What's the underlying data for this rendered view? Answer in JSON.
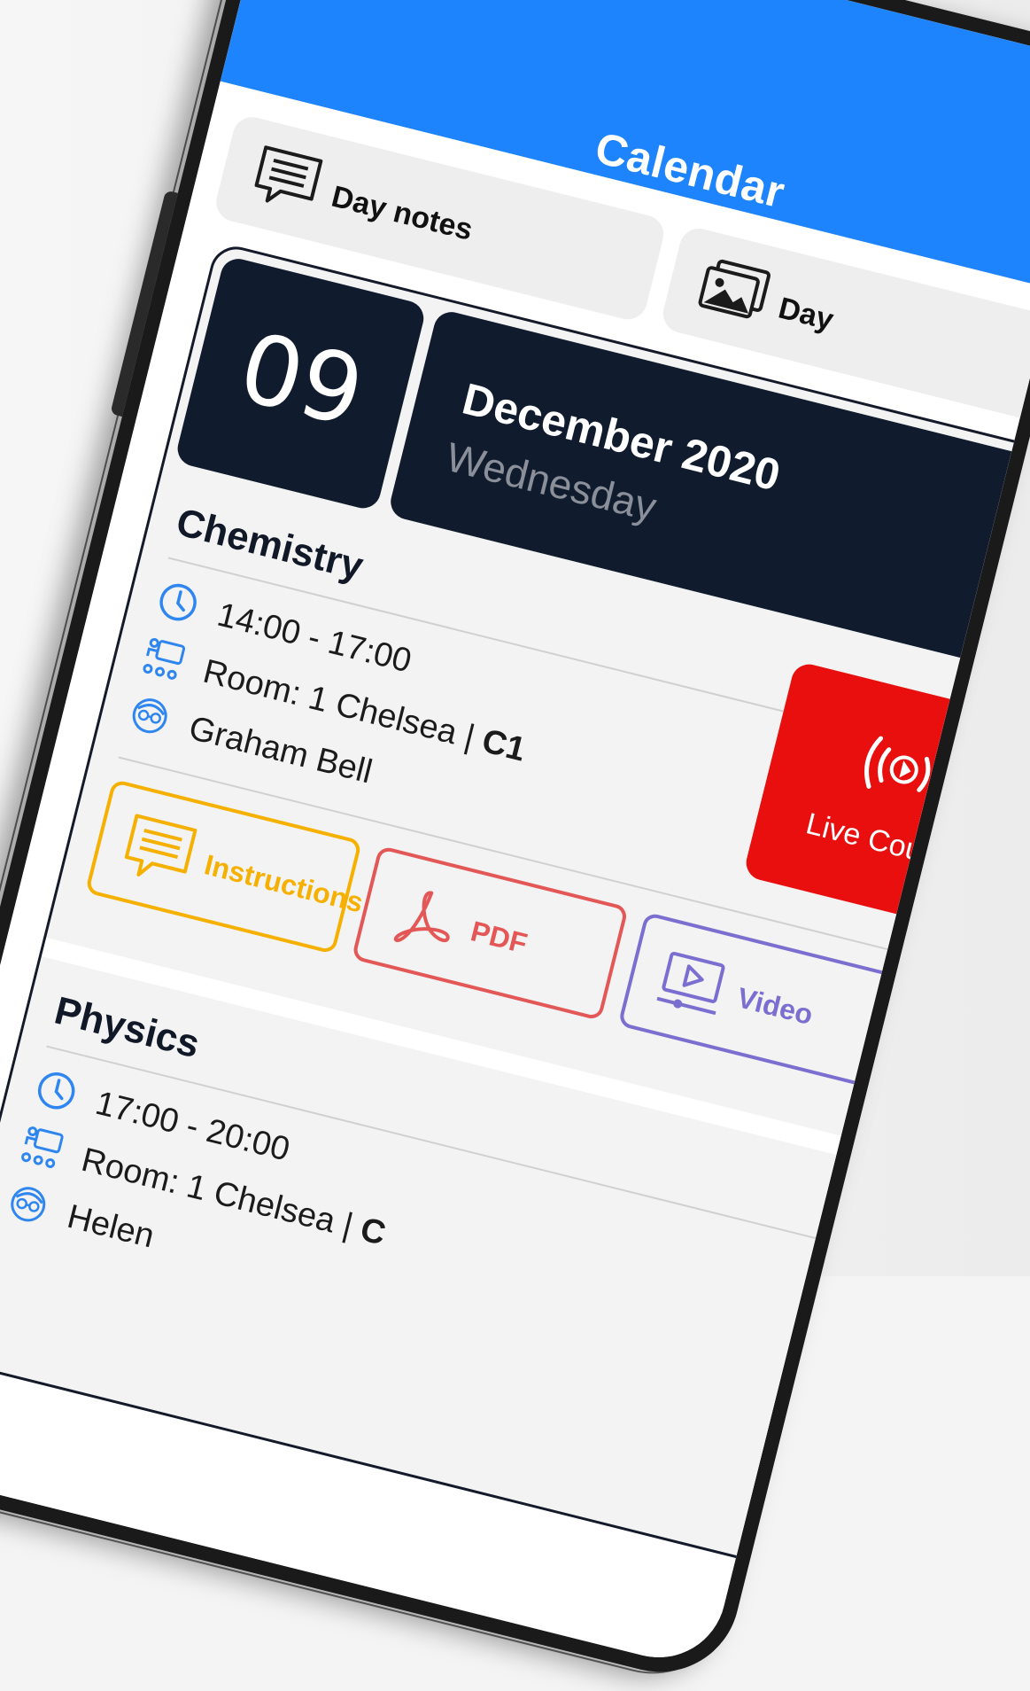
{
  "app": {
    "title": "Calendar",
    "accent_color": "#1e84fd"
  },
  "tiles": {
    "day_notes": {
      "label": "Day notes",
      "icon": "note-bubble-icon"
    },
    "day_pictures": {
      "label": "Day",
      "icon": "image-gallery-icon"
    }
  },
  "date": {
    "day_number": "09",
    "month_year": "December 2020",
    "weekday": "Wednesday"
  },
  "lessons": [
    {
      "subject": "Chemistry",
      "time": "14:00 - 17:00",
      "room_prefix": "Room: 1 Chelsea | ",
      "room_code": "C1",
      "teacher": "Graham Bell",
      "live_label": "Live Course",
      "actions": {
        "instructions": "Instructions",
        "pdf": "PDF",
        "video": "Video"
      }
    },
    {
      "subject": "Physics",
      "time": "17:00 - 20:00",
      "room_prefix": "Room: 1 Chelsea | ",
      "room_code": "C",
      "teacher": "Helen"
    }
  ],
  "colors": {
    "instructions": "#f5b000",
    "pdf": "#e45757",
    "video": "#7a6fd0",
    "live": "#e90f0f",
    "date_header": "#101c2e",
    "info_icons": "#2f86f0"
  }
}
